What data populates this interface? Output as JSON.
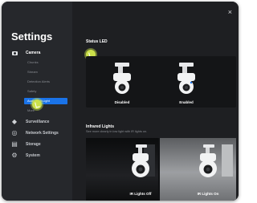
{
  "window": {
    "title": "Settings",
    "close_icon": "×"
  },
  "sidebar": {
    "camera_label": "Camera",
    "sub_items": [
      {
        "label": "Chunks"
      },
      {
        "label": "Stream"
      },
      {
        "label": "Detection Alerts"
      },
      {
        "label": "Safety"
      },
      {
        "label": "Audio and Light",
        "active": true
      },
      {
        "label": "More"
      }
    ],
    "nav": [
      {
        "label": "Surveillance",
        "icon": "shield-icon"
      },
      {
        "label": "Network Settings",
        "icon": "globe-icon"
      },
      {
        "label": "Storage",
        "icon": "storage-icon"
      },
      {
        "label": "System",
        "icon": "gear-icon"
      }
    ]
  },
  "main": {
    "status_led": {
      "title": "Status LED",
      "options": [
        "Disabled",
        "Enabled"
      ]
    },
    "infrared": {
      "title": "Infrared Lights",
      "subtitle": "See more clearly in low light with IR lights on.",
      "options": [
        "IR Lights Off",
        "IR Lights On"
      ]
    }
  },
  "colors": {
    "accent": "#1a73e8",
    "background": "#1e1f22",
    "sidebar": "#26282c",
    "cursor": "#cbe04a"
  }
}
